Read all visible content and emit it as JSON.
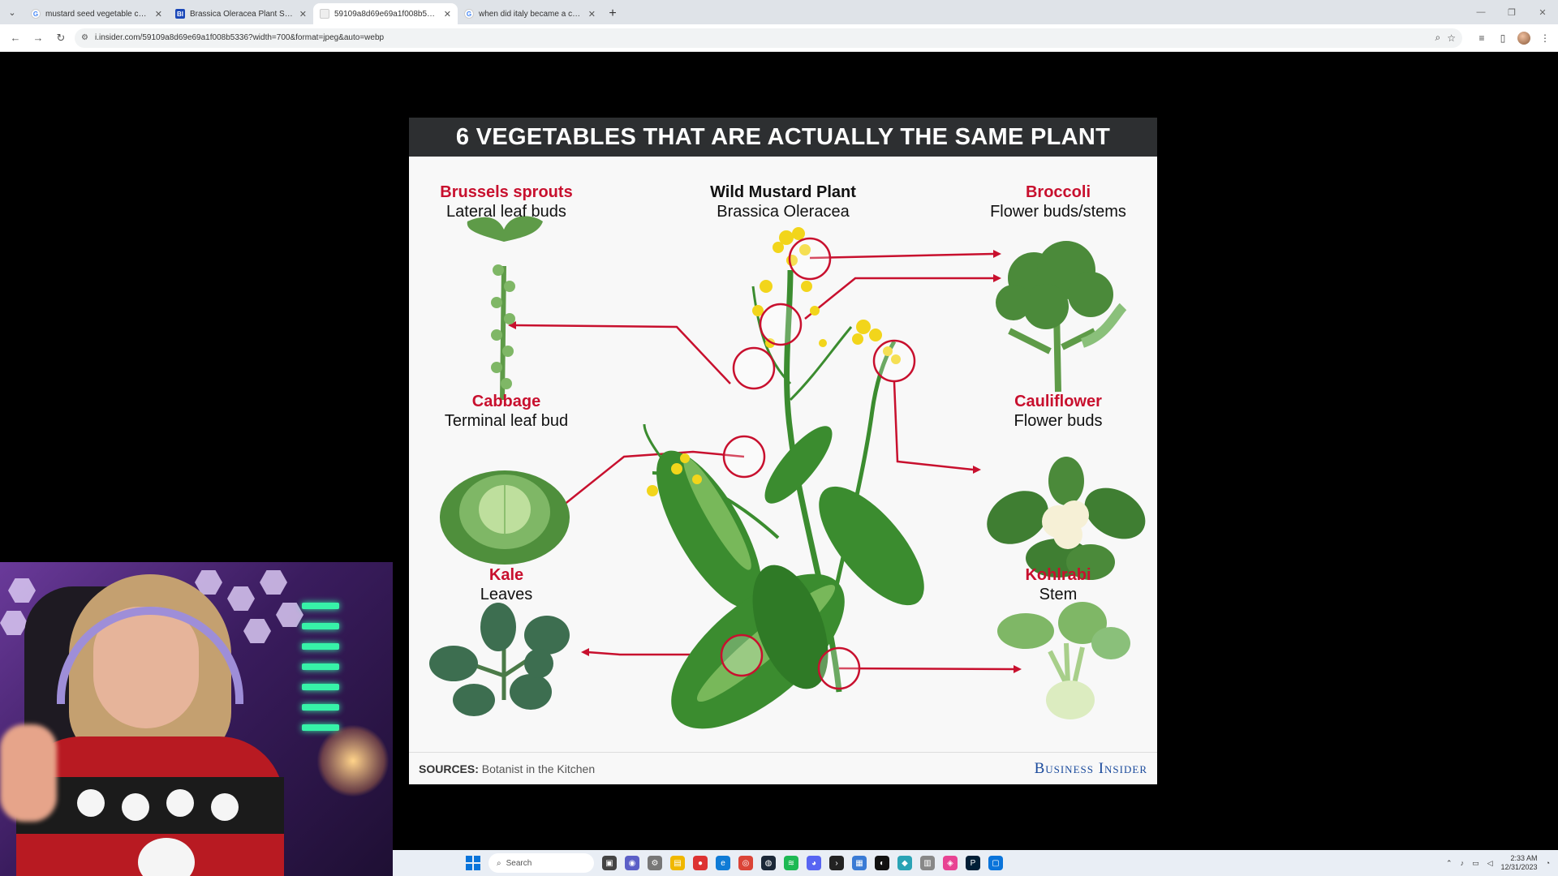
{
  "browser": {
    "tabs": [
      {
        "title": "mustard seed vegetable chart",
        "favicon": "google-g-icon",
        "active": false
      },
      {
        "title": "Brassica Oleracea Plant Species",
        "favicon": "business-insider-icon",
        "active": false
      },
      {
        "title": "59109a8d69e69a1f008b5336",
        "favicon": "image-icon",
        "active": true
      },
      {
        "title": "when did italy became a country",
        "favicon": "google-g-icon",
        "active": false
      }
    ],
    "url": "i.insider.com/59109a8d69e69a1f008b5336?width=700&format=jpeg&auto=webp"
  },
  "infographic": {
    "title": "6 VEGETABLES THAT ARE ACTUALLY THE SAME PLANT",
    "center": {
      "name": "Wild Mustard Plant",
      "species": "Brassica Oleracea"
    },
    "vegetables": [
      {
        "name": "Brussels sprouts",
        "part": "Lateral leaf buds"
      },
      {
        "name": "Broccoli",
        "part": "Flower buds/stems"
      },
      {
        "name": "Cabbage",
        "part": "Terminal leaf bud"
      },
      {
        "name": "Cauliflower",
        "part": "Flower buds"
      },
      {
        "name": "Kale",
        "part": "Leaves"
      },
      {
        "name": "Kohlrabi",
        "part": "Stem"
      }
    ],
    "sources_label": "SOURCES:",
    "sources_value": "Botanist in the Kitchen",
    "publisher": "Business Insider",
    "colors": {
      "accent": "#c8102e",
      "header_bg": "#2d2f31",
      "leaf": "#3b8c2f",
      "leaf_light": "#78b85a",
      "flower": "#f2d51b"
    }
  },
  "taskbar": {
    "search_placeholder": "Search",
    "time": "2:33 AM",
    "date": "12/31/2023"
  }
}
